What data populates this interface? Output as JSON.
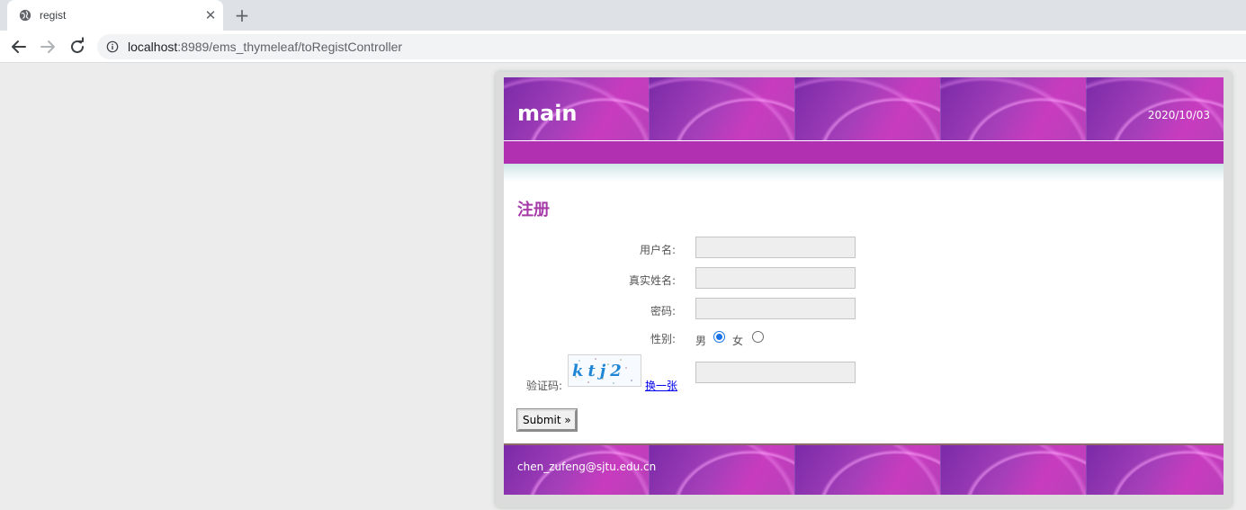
{
  "browser": {
    "tab_title": "regist",
    "new_tab_symbol": "+",
    "close_symbol": "✕",
    "url_host": "localhost",
    "url_rest": ":8989/ems_thymeleaf/toRegistController",
    "icons": [
      "globe-icon",
      "close-icon",
      "plus-icon",
      "back-arrow-icon",
      "forward-arrow-icon",
      "reload-icon",
      "info-icon"
    ]
  },
  "header": {
    "logo": "main",
    "date": "2020/10/03"
  },
  "form": {
    "heading": "注册",
    "username_label": "用户名:",
    "realname_label": "真实姓名:",
    "password_label": "密码:",
    "gender_label": "性别:",
    "gender_options": [
      {
        "label": "男",
        "checked": true
      },
      {
        "label": "女",
        "checked": false
      }
    ],
    "captcha_label": "验证码:",
    "captcha_text": "ktj2",
    "change_link": "换一张",
    "submit_label": "Submit »"
  },
  "footer": {
    "email": "chen_zufeng@sjtu.edu.cn"
  },
  "colors": {
    "brand_purple": "#b12fb1",
    "heading_purple": "#a63ba8",
    "link_blue": "#0000ee",
    "radio_blue": "#1a73e8"
  }
}
